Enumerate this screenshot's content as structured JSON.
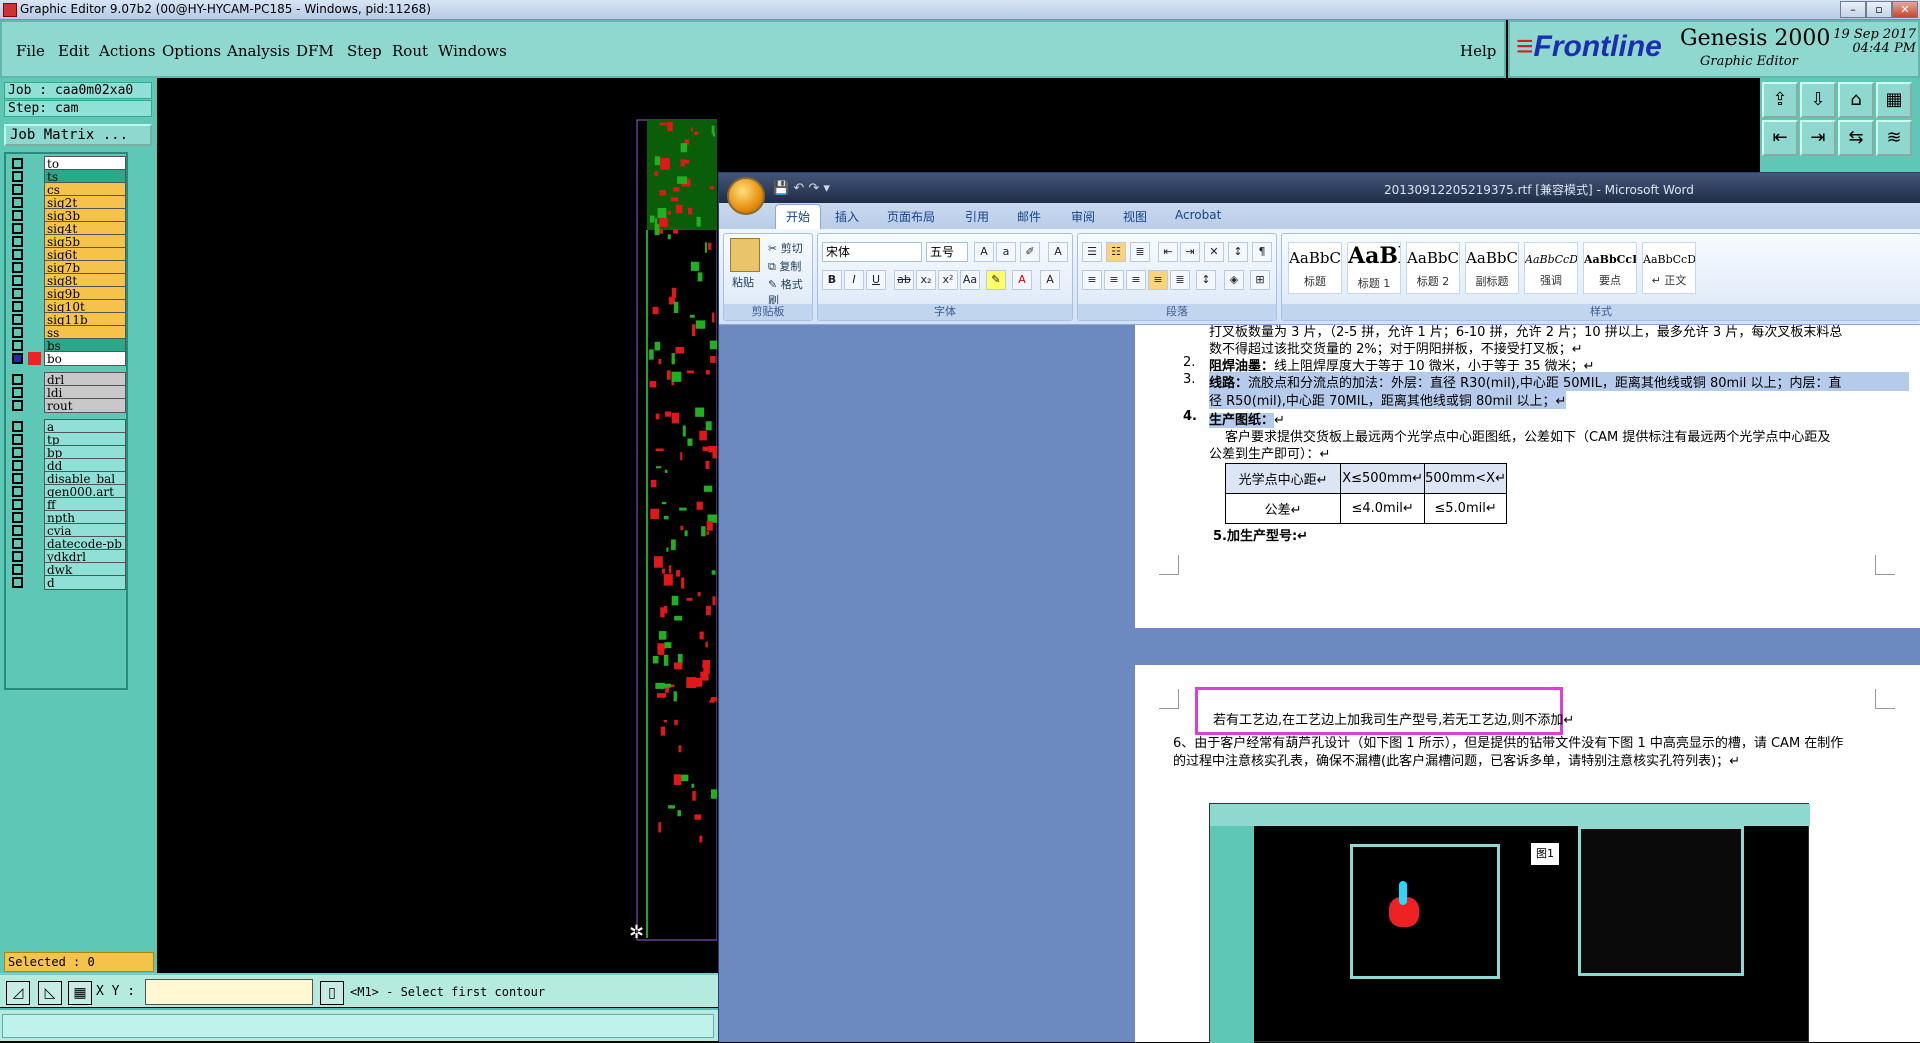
{
  "genesis": {
    "title": "Graphic Editor 9.07b2 (00@HY-HYCAM-PC185 - Windows, pid:11268)",
    "menu": [
      "File",
      "Edit",
      "Actions",
      "Options",
      "Analysis",
      "DFM",
      "Step",
      "Rout",
      "Windows"
    ],
    "help": "Help",
    "logo": {
      "brand_prefix": "≡",
      "brand": "Frontline",
      "product": "Genesis 2000",
      "subtitle": "Graphic Editor",
      "date": "19 Sep 2017",
      "time": "04:44 PM"
    },
    "job": "Job : caa0m02xa0",
    "step": "Step: cam",
    "job_matrix": "Job Matrix ...",
    "layers": [
      {
        "name": "to",
        "color": "#ffffff"
      },
      {
        "name": "ts",
        "color": "#2aa88a"
      },
      {
        "name": "cs",
        "color": "#f5c34a"
      },
      {
        "name": "sig2t",
        "color": "#f5c34a"
      },
      {
        "name": "sig3b",
        "color": "#f5c34a"
      },
      {
        "name": "sig4t",
        "color": "#f5c34a"
      },
      {
        "name": "sig5b",
        "color": "#f5c34a"
      },
      {
        "name": "sig6t",
        "color": "#f5c34a"
      },
      {
        "name": "sig7b",
        "color": "#f5c34a"
      },
      {
        "name": "sig8t",
        "color": "#f5c34a"
      },
      {
        "name": "sig9b",
        "color": "#f5c34a"
      },
      {
        "name": "sig10t",
        "color": "#f5c34a"
      },
      {
        "name": "sig11b",
        "color": "#f5c34a"
      },
      {
        "name": "ss",
        "color": "#f5c34a"
      },
      {
        "name": "bs",
        "color": "#2aa88a"
      },
      {
        "name": "bo",
        "color": "#ffffff"
      },
      {
        "name": "drl",
        "color": "#c8c8c8"
      },
      {
        "name": "ldi",
        "color": "#c8c8c8"
      },
      {
        "name": "rout",
        "color": "#c8c8c8"
      },
      {
        "name": "a",
        "color": "#8fe0d6"
      },
      {
        "name": "tp",
        "color": "#8fe0d6"
      },
      {
        "name": "bp",
        "color": "#8fe0d6"
      },
      {
        "name": "dd",
        "color": "#8fe0d6"
      },
      {
        "name": "disable_bal",
        "color": "#8fe0d6"
      },
      {
        "name": "gen000.art",
        "color": "#8fe0d6"
      },
      {
        "name": "ff",
        "color": "#8fe0d6"
      },
      {
        "name": "npth",
        "color": "#8fe0d6"
      },
      {
        "name": "cvia",
        "color": "#8fe0d6"
      },
      {
        "name": "datecode-pb",
        "color": "#8fe0d6"
      },
      {
        "name": "ydkdrl",
        "color": "#8fe0d6"
      },
      {
        "name": "dwk",
        "color": "#8fe0d6"
      },
      {
        "name": "d",
        "color": "#8fe0d6"
      }
    ],
    "selected": "Selected : 0",
    "xy_label": "X Y :",
    "xy_value": "",
    "status_msg": "<M1> - Select first contour"
  },
  "word": {
    "title": "20130912205219375.rtf [兼容模式] - Microsoft Word",
    "tabs": [
      "开始",
      "插入",
      "页面布局",
      "引用",
      "邮件",
      "审阅",
      "视图",
      "Acrobat"
    ],
    "clipboard": {
      "paste": "粘贴",
      "cut": "剪切",
      "copy": "复制",
      "format": "格式刷",
      "label": "剪贴板"
    },
    "font": {
      "name": "宋体",
      "size": "五号",
      "label": "字体"
    },
    "paragraph_label": "段落",
    "styles_label": "样式",
    "styles": [
      {
        "sample": "AaBbC",
        "name": "标题"
      },
      {
        "sample": "AaBl",
        "name": "标题 1"
      },
      {
        "sample": "AaBbC",
        "name": "标题 2"
      },
      {
        "sample": "AaBbC",
        "name": "副标题"
      },
      {
        "sample": "AaBbCcD",
        "name": "强调"
      },
      {
        "sample": "AaBbCcD",
        "name": "要点"
      },
      {
        "sample": "AaBbCcD",
        "name": "↵ 正文"
      }
    ],
    "doc": {
      "line0a": "打叉板数量为 3 片，（2-5 拼，允许 1 片；6-10 拼，允许 2 片；10 拼以上，最多允许 3 片，每次叉板末料总",
      "line0b": "数不得超过该批交货量的 2%；对于阴阳拼板，不接受打叉板；↵",
      "i2_num": "2.",
      "i2_bold": "阻焊油墨：",
      "i2_text": "线上阻焊厚度大于等于 10 微米，小于等于 35 微米；↵",
      "i3_num": "3.",
      "i3_bold": "线路：",
      "i3_text": "流胶点和分流点的加法：外层：直径 R30(mil),中心距 50MIL，距离其他线或铜 80mil 以上；内层：直",
      "i3_text2": "径 R50(mil),中心距 70MIL，距离其他线或铜 80mil 以上；↵",
      "i4_num": "4.",
      "i4_bold": "生产图纸：",
      "i4_mark": "↵",
      "i4_text": "客户要求提供交货板上最远两个光学点中心距图纸，公差如下（CAM 提供标注有最远两个光学点中心距及",
      "i4_text2": "公差到生产即可）：↵",
      "table": [
        [
          "光学点中心距↵",
          "X≤500mm↵",
          "500mm<X↵"
        ],
        [
          "公差↵",
          "≤4.0mil↵",
          "≤5.0mil↵"
        ]
      ],
      "i5": "5.加生产型号:↵",
      "p2_box": "若有工艺边,在工艺边上加我司生产型号,若无工艺边,则不添加↵",
      "p2_6a": "6、由于客户经常有葫芦孔设计（如下图 1 所示），但是提供的钻带文件没有下图 1 中高亮显示的槽，请 CAM 在制作",
      "p2_6b": "的过程中注意核实孔表，确保不漏槽(此客户漏槽问题，已客诉多单，请特别注意核实孔符列表)；↵",
      "fig_label": "图1"
    }
  }
}
